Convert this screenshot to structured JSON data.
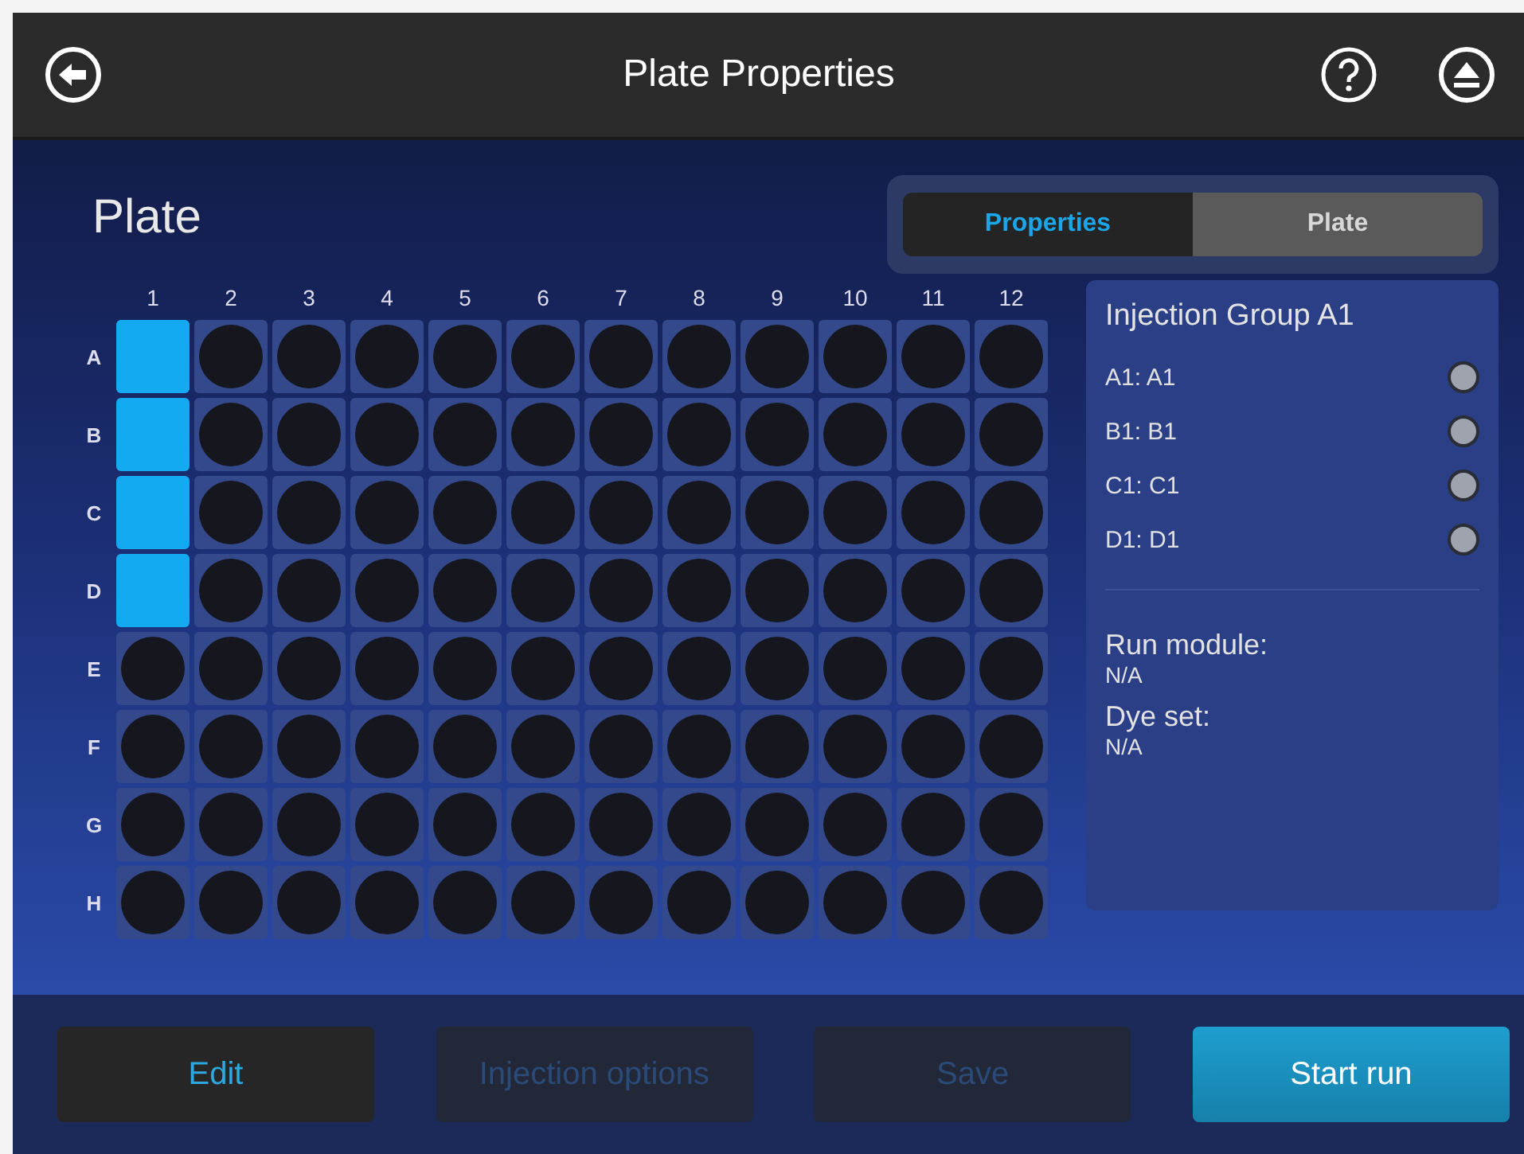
{
  "window": {
    "title": "Plate Properties"
  },
  "section_title": "Plate",
  "tabs": [
    {
      "label": "Properties",
      "selected": true
    },
    {
      "label": "Plate",
      "selected": false
    }
  ],
  "plate": {
    "columns": [
      "1",
      "2",
      "3",
      "4",
      "5",
      "6",
      "7",
      "8",
      "9",
      "10",
      "11",
      "12"
    ],
    "rows": [
      {
        "label": "A",
        "wells": [
          {
            "selected": true
          },
          {
            "selected": false
          },
          {
            "selected": false
          },
          {
            "selected": false
          },
          {
            "selected": false
          },
          {
            "selected": false
          },
          {
            "selected": false
          },
          {
            "selected": false
          },
          {
            "selected": false
          },
          {
            "selected": false
          },
          {
            "selected": false
          },
          {
            "selected": false
          }
        ]
      },
      {
        "label": "B",
        "wells": [
          {
            "selected": true
          },
          {
            "selected": false
          },
          {
            "selected": false
          },
          {
            "selected": false
          },
          {
            "selected": false
          },
          {
            "selected": false
          },
          {
            "selected": false
          },
          {
            "selected": false
          },
          {
            "selected": false
          },
          {
            "selected": false
          },
          {
            "selected": false
          },
          {
            "selected": false
          }
        ]
      },
      {
        "label": "C",
        "wells": [
          {
            "selected": true
          },
          {
            "selected": false
          },
          {
            "selected": false
          },
          {
            "selected": false
          },
          {
            "selected": false
          },
          {
            "selected": false
          },
          {
            "selected": false
          },
          {
            "selected": false
          },
          {
            "selected": false
          },
          {
            "selected": false
          },
          {
            "selected": false
          },
          {
            "selected": false
          }
        ]
      },
      {
        "label": "D",
        "wells": [
          {
            "selected": true
          },
          {
            "selected": false
          },
          {
            "selected": false
          },
          {
            "selected": false
          },
          {
            "selected": false
          },
          {
            "selected": false
          },
          {
            "selected": false
          },
          {
            "selected": false
          },
          {
            "selected": false
          },
          {
            "selected": false
          },
          {
            "selected": false
          },
          {
            "selected": false
          }
        ]
      },
      {
        "label": "E",
        "wells": [
          {
            "selected": false
          },
          {
            "selected": false
          },
          {
            "selected": false
          },
          {
            "selected": false
          },
          {
            "selected": false
          },
          {
            "selected": false
          },
          {
            "selected": false
          },
          {
            "selected": false
          },
          {
            "selected": false
          },
          {
            "selected": false
          },
          {
            "selected": false
          },
          {
            "selected": false
          }
        ]
      },
      {
        "label": "F",
        "wells": [
          {
            "selected": false
          },
          {
            "selected": false
          },
          {
            "selected": false
          },
          {
            "selected": false
          },
          {
            "selected": false
          },
          {
            "selected": false
          },
          {
            "selected": false
          },
          {
            "selected": false
          },
          {
            "selected": false
          },
          {
            "selected": false
          },
          {
            "selected": false
          },
          {
            "selected": false
          }
        ]
      },
      {
        "label": "G",
        "wells": [
          {
            "selected": false
          },
          {
            "selected": false
          },
          {
            "selected": false
          },
          {
            "selected": false
          },
          {
            "selected": false
          },
          {
            "selected": false
          },
          {
            "selected": false
          },
          {
            "selected": false
          },
          {
            "selected": false
          },
          {
            "selected": false
          },
          {
            "selected": false
          },
          {
            "selected": false
          }
        ]
      },
      {
        "label": "H",
        "wells": [
          {
            "selected": false
          },
          {
            "selected": false
          },
          {
            "selected": false
          },
          {
            "selected": false
          },
          {
            "selected": false
          },
          {
            "selected": false
          },
          {
            "selected": false
          },
          {
            "selected": false
          },
          {
            "selected": false
          },
          {
            "selected": false
          },
          {
            "selected": false
          },
          {
            "selected": false
          }
        ]
      }
    ]
  },
  "injection_group": {
    "title": "Injection Group A1",
    "wells": [
      {
        "label": "A1: A1"
      },
      {
        "label": "B1: B1"
      },
      {
        "label": "C1: C1"
      },
      {
        "label": "D1: D1"
      }
    ],
    "details": [
      {
        "label": "Run module:",
        "value": "N/A"
      },
      {
        "label": "Dye set:",
        "value": "N/A"
      }
    ]
  },
  "buttons": [
    {
      "label": "Edit",
      "kind": "normal"
    },
    {
      "label": "Injection options",
      "kind": "disabled"
    },
    {
      "label": "Save",
      "kind": "disabled"
    },
    {
      "label": "Start run",
      "kind": "primary"
    }
  ]
}
